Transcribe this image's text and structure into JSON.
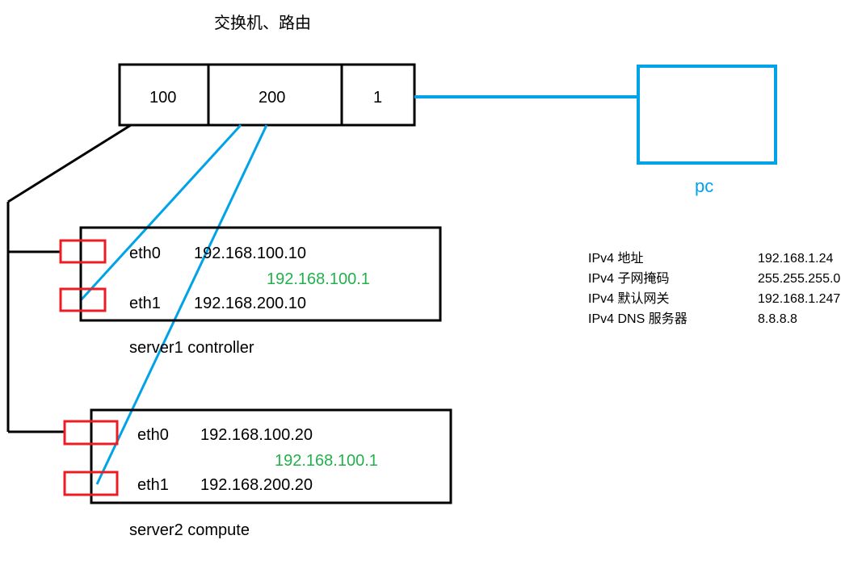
{
  "switch": {
    "title": "交换机、路由",
    "ports": [
      "100",
      "200",
      "1"
    ]
  },
  "pc": {
    "label": "pc",
    "ipv4": [
      {
        "label": "IPv4 地址",
        "value": "192.168.1.24"
      },
      {
        "label": "IPv4 子网掩码",
        "value": "255.255.255.0"
      },
      {
        "label": "IPv4 默认网关",
        "value": "192.168.1.247"
      },
      {
        "label": "IPv4 DNS 服务器",
        "value": "8.8.8.8"
      }
    ]
  },
  "server1": {
    "name": "server1   controller",
    "eth0": {
      "if": "eth0",
      "ip": "192.168.100.10"
    },
    "eth1": {
      "if": "eth1",
      "ip": "192.168.200.10"
    },
    "gateway": "192.168.100.1"
  },
  "server2": {
    "name": "server2   compute",
    "eth0": {
      "if": "eth0",
      "ip": "192.168.100.20"
    },
    "eth1": {
      "if": "eth1",
      "ip": "192.168.200.20"
    },
    "gateway": "192.168.100.1"
  }
}
